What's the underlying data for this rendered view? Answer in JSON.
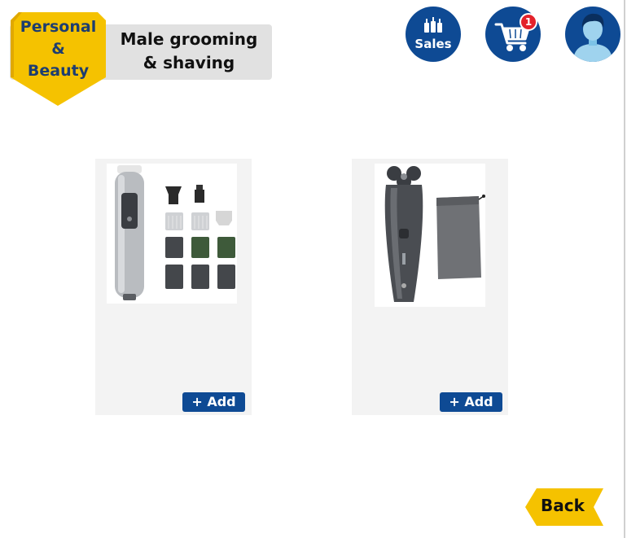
{
  "category": {
    "label": "Personal & Beauty",
    "lines": [
      "Personal",
      "&",
      "Beauty"
    ]
  },
  "subcategory": {
    "lines": [
      "Male grooming",
      "& shaving"
    ]
  },
  "header": {
    "sales_label": "Sales",
    "cart_count": "1",
    "icons": [
      "sales-bottles-icon",
      "shopping-cart-icon",
      "user-avatar-icon"
    ]
  },
  "products": [
    {
      "image": "multigroom-trimmer-kit-image",
      "add_label": "+ Add"
    },
    {
      "image": "electric-shaver-with-pouch-image",
      "add_label": "+ Add"
    }
  ],
  "back_label": "Back",
  "colors": {
    "primary": "#0e4a94",
    "accent": "#f5c200",
    "category_text": "#1d3d70",
    "badge": "#e3222b",
    "card_bg": "#f3f3f3"
  }
}
